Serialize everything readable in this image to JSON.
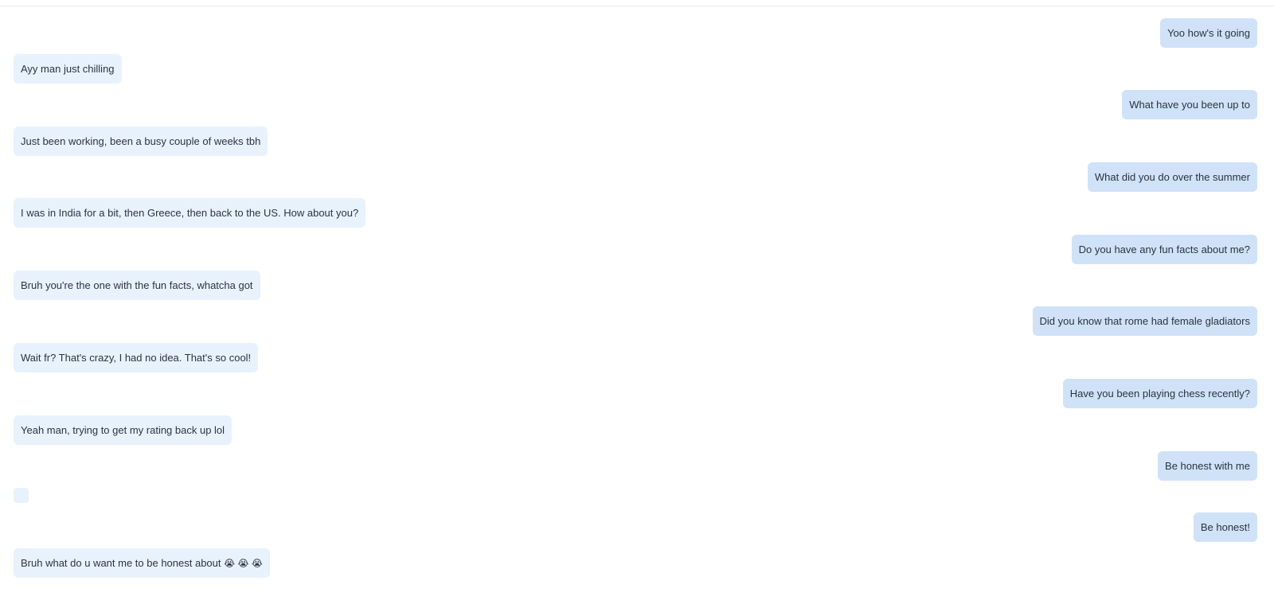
{
  "conversation": {
    "messages": [
      {
        "sender": "me",
        "text": "Yoo how's it going"
      },
      {
        "sender": "them",
        "text": "Ayy man just chilling"
      },
      {
        "sender": "me",
        "text": "What have you been up to"
      },
      {
        "sender": "them",
        "text": "Just been working, been a busy couple of weeks tbh"
      },
      {
        "sender": "me",
        "text": "What did you do over the summer"
      },
      {
        "sender": "them",
        "text": "I was in India for a bit, then Greece, then back to the US. How about you?"
      },
      {
        "sender": "me",
        "text": "Do you have any fun facts about me?"
      },
      {
        "sender": "them",
        "text": "Bruh you're the one with the fun facts, whatcha got"
      },
      {
        "sender": "me",
        "text": "Did you know that rome had female gladiators"
      },
      {
        "sender": "them",
        "text": "Wait fr? That's crazy, I had no idea. That's so cool!"
      },
      {
        "sender": "me",
        "text": "Have you been playing chess recently?"
      },
      {
        "sender": "them",
        "text": "Yeah man, trying to get my rating back up lol"
      },
      {
        "sender": "me",
        "text": "Be honest with me"
      },
      {
        "sender": "them",
        "text": ""
      },
      {
        "sender": "me",
        "text": "Be honest!"
      },
      {
        "sender": "them",
        "text": "Bruh what do u want me to be honest about",
        "emoji": "😭 😭 😭"
      }
    ]
  },
  "colors": {
    "incoming_bubble": "#e8f2fd",
    "outgoing_bubble": "#cfe2f8",
    "text": "#2b3440"
  }
}
